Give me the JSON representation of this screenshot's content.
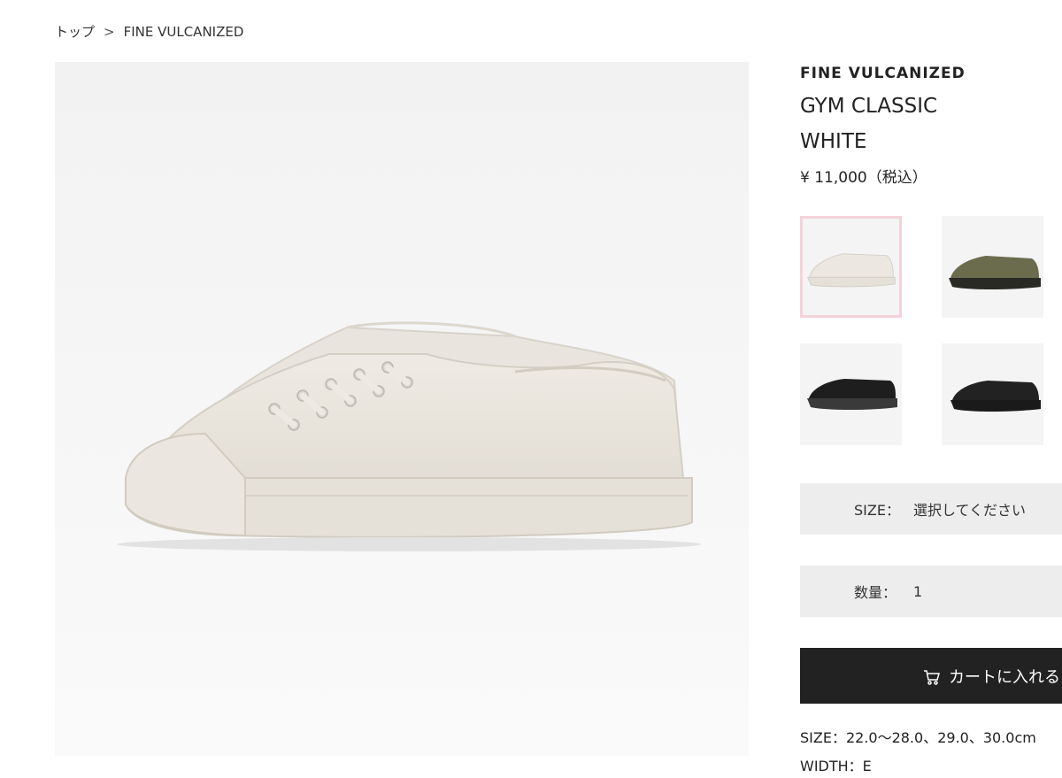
{
  "breadcrumb": {
    "home": "トップ",
    "separator": ">",
    "current": "FINE VULCANIZED"
  },
  "product": {
    "brand": "FINE VULCANIZED",
    "name": "GYM CLASSIC",
    "color": "WHITE",
    "price": "¥ 11,000（税込）"
  },
  "variants": [
    {
      "color_name": "white",
      "selected": true,
      "upper": "#ece8e1",
      "sole": "#e6e1d8"
    },
    {
      "color_name": "olive",
      "selected": false,
      "upper": "#6b6b4e",
      "sole": "#2a2a25"
    },
    {
      "color_name": "black-white-sole",
      "selected": false,
      "upper": "#1e1e1e",
      "sole": "#3a3a3a"
    },
    {
      "color_name": "black",
      "selected": false,
      "upper": "#222222",
      "sole": "#1a1a1a"
    }
  ],
  "size_selector": {
    "label": "SIZE：",
    "value": "選択してください"
  },
  "quantity_selector": {
    "label": "数量：",
    "value": "1"
  },
  "cart_button": {
    "label": "カートに入れる",
    "icon": "cart-icon"
  },
  "specs": {
    "size": "SIZE：22.0〜28.0、29.0、30.0cm",
    "width": "WIDTH：E"
  },
  "colors": {
    "selected_border": "#f3d3d9",
    "selector_bg": "#ededed",
    "button_bg": "#222222"
  }
}
